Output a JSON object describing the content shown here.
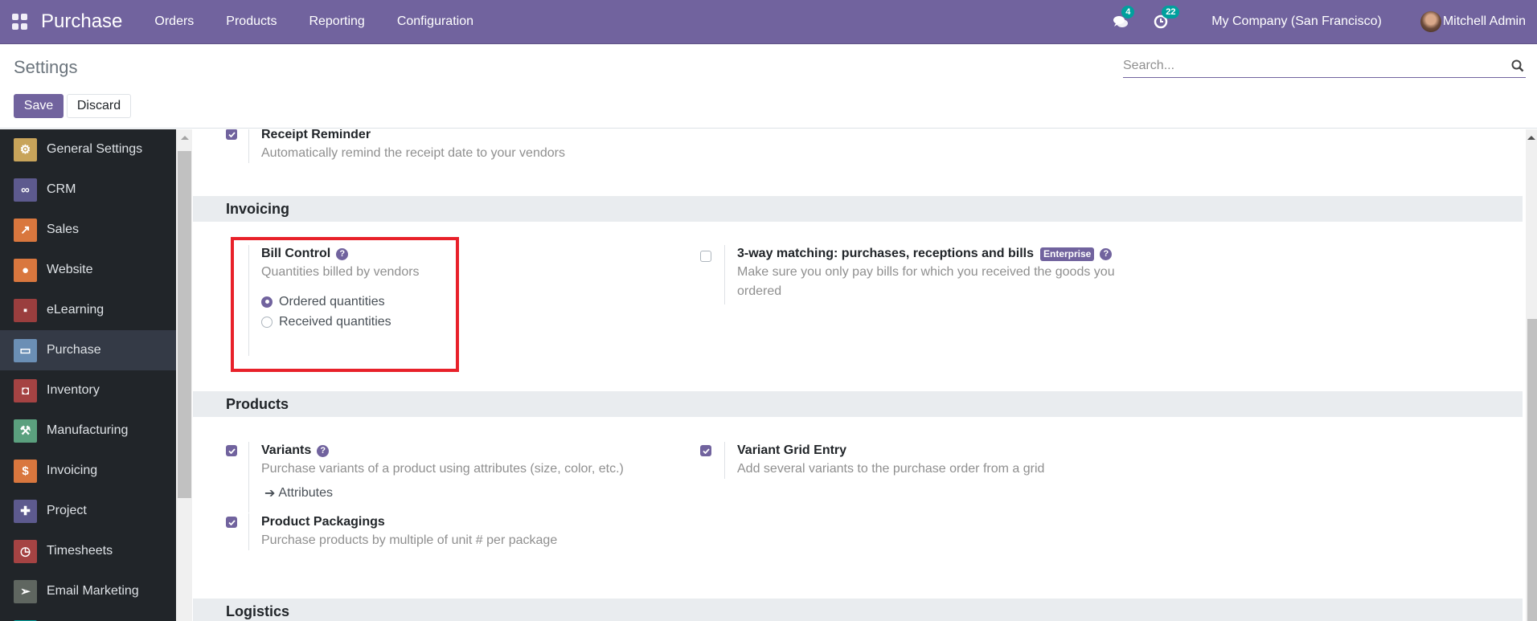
{
  "navbar": {
    "app_name": "Purchase",
    "menu": [
      "Orders",
      "Products",
      "Reporting",
      "Configuration"
    ],
    "messages_count": "4",
    "activities_count": "22",
    "company": "My Company (San Francisco)",
    "user": "Mitchell Admin"
  },
  "control": {
    "title": "Settings",
    "save_label": "Save",
    "discard_label": "Discard",
    "search_placeholder": "Search..."
  },
  "sidebar": {
    "items": [
      {
        "label": "General Settings",
        "icon": "gear-icon",
        "color": "#c8a45a"
      },
      {
        "label": "CRM",
        "icon": "handshake-icon",
        "color": "#5d5a8e"
      },
      {
        "label": "Sales",
        "icon": "chart-icon",
        "color": "#d9773e"
      },
      {
        "label": "Website",
        "icon": "globe-icon",
        "color": "#d9773e"
      },
      {
        "label": "eLearning",
        "icon": "presentation-icon",
        "color": "#9a3e3e"
      },
      {
        "label": "Purchase",
        "icon": "credit-card-icon",
        "color": "#6b8fb5",
        "active": true
      },
      {
        "label": "Inventory",
        "icon": "box-icon",
        "color": "#a54343"
      },
      {
        "label": "Manufacturing",
        "icon": "wrench-icon",
        "color": "#5ba07e"
      },
      {
        "label": "Invoicing",
        "icon": "invoice-icon",
        "color": "#d9773e"
      },
      {
        "label": "Project",
        "icon": "puzzle-icon",
        "color": "#5d5a8e"
      },
      {
        "label": "Timesheets",
        "icon": "stopwatch-icon",
        "color": "#a54343"
      },
      {
        "label": "Email Marketing",
        "icon": "paper-plane-icon",
        "color": "#5f6660"
      }
    ]
  },
  "content": {
    "receipt_reminder": {
      "title": "Receipt Reminder",
      "desc": "Automatically remind the receipt date to your vendors",
      "checked": true
    },
    "sections": {
      "invoicing": "Invoicing",
      "products": "Products",
      "logistics": "Logistics"
    },
    "bill_control": {
      "title": "Bill Control",
      "desc": "Quantities billed by vendors",
      "options": [
        "Ordered quantities",
        "Received quantities"
      ],
      "selected": "Ordered quantities"
    },
    "three_way": {
      "title": "3-way matching: purchases, receptions and bills",
      "badge": "Enterprise",
      "desc": "Make sure you only pay bills for which you received the goods you ordered",
      "checked": false
    },
    "variants": {
      "title": "Variants",
      "desc": "Purchase variants of a product using attributes (size, color, etc.)",
      "link": "Attributes",
      "checked": true
    },
    "variant_grid": {
      "title": "Variant Grid Entry",
      "desc": "Add several variants to the purchase order from a grid",
      "checked": true
    },
    "packagings": {
      "title": "Product Packagings",
      "desc": "Purchase products by multiple of unit # per package",
      "checked": true
    }
  }
}
